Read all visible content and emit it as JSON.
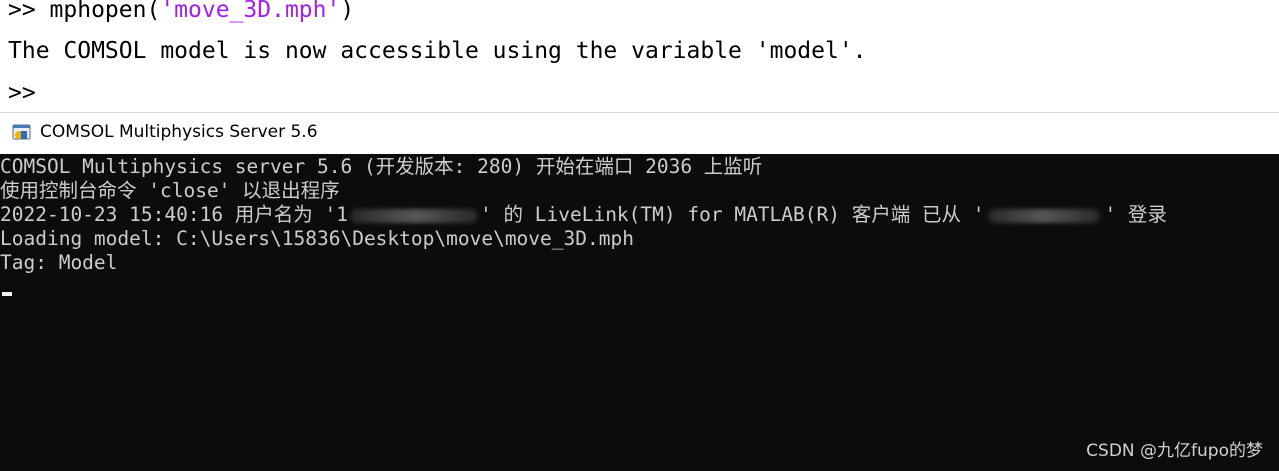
{
  "matlab": {
    "line1_prompt": ">> ",
    "line1_cmd": "mphopen(",
    "line1_arg": "'move_3D.mph'",
    "line1_close": ")",
    "line2": "The COMSOL model is now accessible using the variable 'model'.",
    "line3_prompt": ">>"
  },
  "server_window": {
    "title": "COMSOL Multiphysics Server 5.6",
    "icon": "comsol-app-icon"
  },
  "console": {
    "line0": "COMSOL Multiphysics server 5.6 (开发版本: 280) 开始在端口 2036 上监听",
    "line1": "使用控制台命令 'close' 以退出程序",
    "line2_a": "2022-10-23 15:40:16 用户名为 '1",
    "line2_b": "' 的 LiveLink(TM) for MATLAB(R) 客户端 已从 '",
    "line2_c": "' 登录",
    "line3": "Loading model: C:\\Users\\15836\\Desktop\\move\\move_3D.mph",
    "line4": "Tag: Model"
  },
  "watermark": "CSDN @九亿fupo的梦",
  "colors": {
    "string": "#a020f0",
    "console_bg": "#0c0c0c",
    "console_fg": "#cccccc"
  }
}
